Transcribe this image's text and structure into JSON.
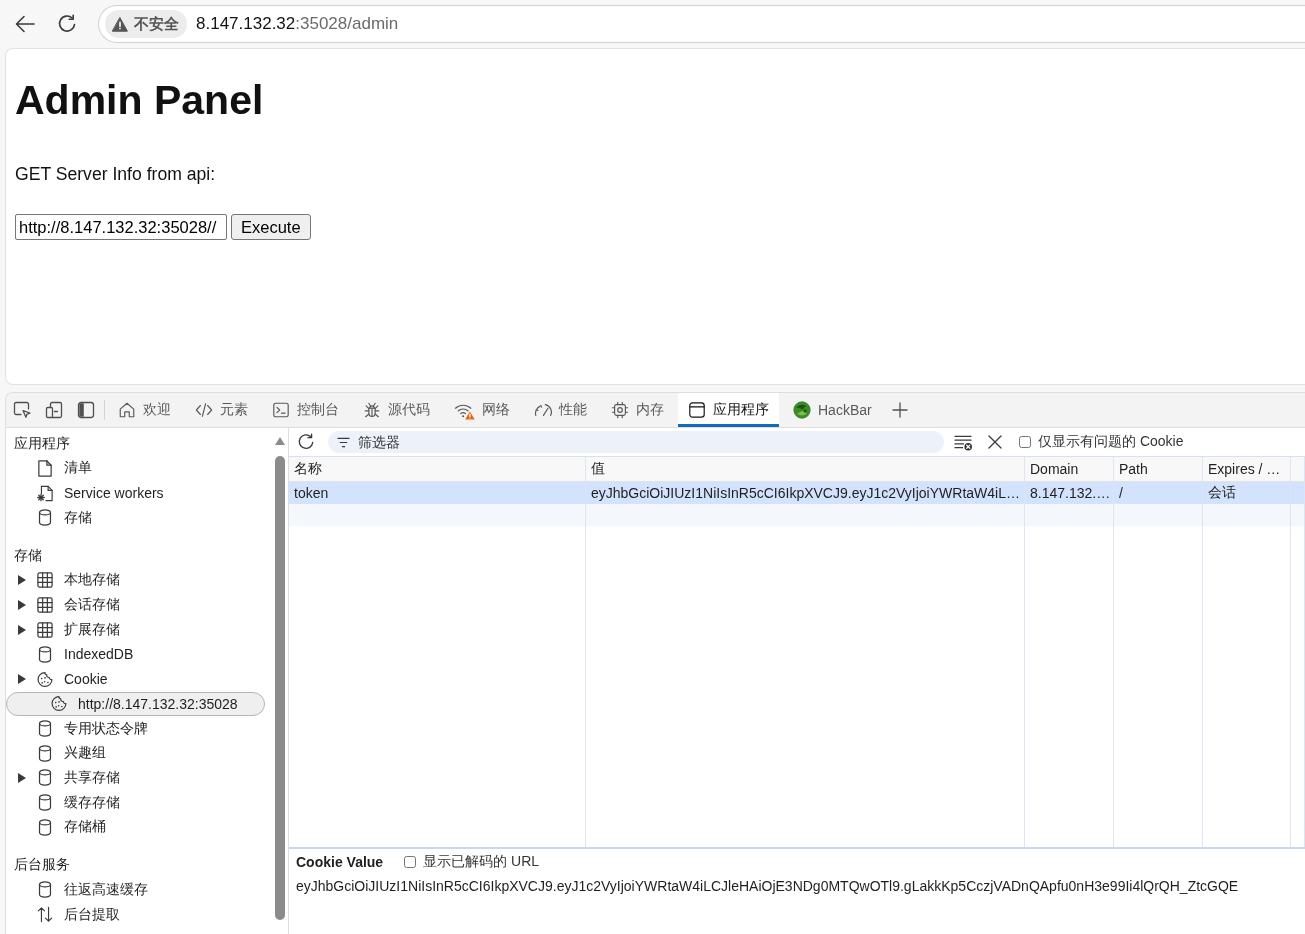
{
  "browser": {
    "security_label": "不安全",
    "url_host": "8.147.132.32",
    "url_rest": ":35028/admin"
  },
  "page": {
    "title": "Admin Panel",
    "prompt": "GET Server Info from api:",
    "api_url": {
      "value": "http://8.147.132.32:35028//"
    },
    "execute_button": "Execute"
  },
  "devtools": {
    "tabs": [
      {
        "kind": "home",
        "label": "欢迎",
        "selected": false,
        "warning": false
      },
      {
        "kind": "code",
        "label": "元素",
        "selected": false,
        "warning": false
      },
      {
        "kind": "console",
        "label": "控制台",
        "selected": false,
        "warning": false
      },
      {
        "kind": "bug",
        "label": "源代码",
        "selected": false,
        "warning": false
      },
      {
        "kind": "wifi",
        "label": "网络",
        "selected": false,
        "warning": true
      },
      {
        "kind": "gauge",
        "label": "性能",
        "selected": false,
        "warning": false
      },
      {
        "kind": "chip",
        "label": "内存",
        "selected": false,
        "warning": false
      },
      {
        "kind": "window",
        "label": "应用程序",
        "selected": true,
        "warning": false
      },
      {
        "kind": "orb",
        "label": "HackBar",
        "selected": false,
        "warning": false
      }
    ],
    "sidebar": {
      "sections": [
        {
          "title": "应用程序",
          "items": [
            {
              "kind": "file",
              "label": "清单",
              "expandable": false,
              "selected": false
            },
            {
              "kind": "file-gear",
              "label": "Service workers",
              "expandable": false,
              "selected": false
            },
            {
              "kind": "database",
              "label": "存储",
              "expandable": false,
              "selected": false
            }
          ]
        },
        {
          "title": "存储",
          "items": [
            {
              "kind": "grid",
              "label": "本地存储",
              "expandable": true,
              "selected": false
            },
            {
              "kind": "grid",
              "label": "会话存储",
              "expandable": true,
              "selected": false
            },
            {
              "kind": "grid",
              "label": "扩展存储",
              "expandable": true,
              "selected": false
            },
            {
              "kind": "database",
              "label": "IndexedDB",
              "expandable": false,
              "selected": false
            },
            {
              "kind": "cookie",
              "label": "Cookie",
              "expandable": true,
              "selected": false,
              "children": [
                {
                  "kind": "cookie",
                  "label": "http://8.147.132.32:35028",
                  "expandable": false,
                  "selected": true
                }
              ]
            },
            {
              "kind": "database",
              "label": "专用状态令牌",
              "expandable": false,
              "selected": false
            },
            {
              "kind": "database",
              "label": "兴趣组",
              "expandable": false,
              "selected": false
            },
            {
              "kind": "database",
              "label": "共享存储",
              "expandable": true,
              "selected": false
            },
            {
              "kind": "database",
              "label": "缓存存储",
              "expandable": false,
              "selected": false
            },
            {
              "kind": "database",
              "label": "存储桶",
              "expandable": false,
              "selected": false
            }
          ]
        },
        {
          "title": "后台服务",
          "items": [
            {
              "kind": "database",
              "label": "往返高速缓存",
              "expandable": false,
              "selected": false
            },
            {
              "kind": "arrows",
              "label": "后台提取",
              "expandable": false,
              "selected": false
            }
          ]
        }
      ]
    },
    "toolbar": {
      "filter": {
        "placeholder": "筛选器"
      },
      "issues_only": {
        "label": "仅显示有问题的 Cookie",
        "checked": false
      }
    },
    "table": {
      "columns": [
        "名称",
        "值",
        "Domain",
        "Path",
        "Expires / …"
      ],
      "rows": [
        {
          "cells": [
            "token",
            "eyJhbGciOiJIUzI1NiIsInR5cCI6IkpXVCJ9.eyJ1c2VyIjoiYWRtaW4iL…",
            "8.147.132.…",
            "/",
            "会话"
          ],
          "selected": true
        }
      ]
    },
    "detail": {
      "title": "Cookie Value",
      "show_decoded": {
        "label": "显示已解码的 URL",
        "checked": false
      },
      "value": "eyJhbGciOiJIUzI1NiIsInR5cCI6IkpXVCJ9.eyJ1c2VyIjoiYWRtaW4iLCJleHAiOjE3NDg0MTQwOTl9.gLakkKp5CczjVADnQApfu0nH3e99Ii4lQrQH_ZtcGQE"
    }
  }
}
